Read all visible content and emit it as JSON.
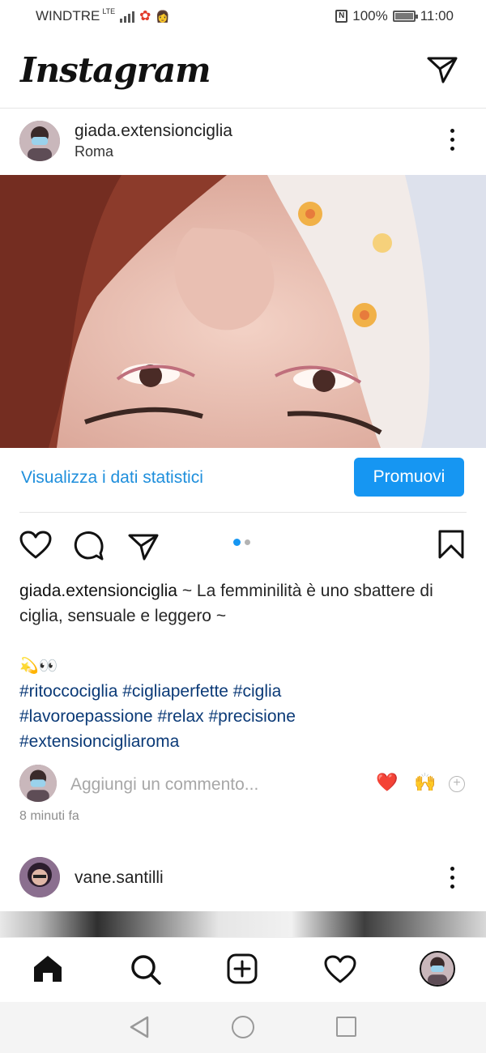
{
  "status_bar": {
    "carrier": "WINDTRE",
    "network": "LTE",
    "battery_percent": "100%",
    "time": "11:00"
  },
  "app": {
    "title": "Instagram"
  },
  "post": {
    "username": "giada.extensionciglia",
    "location": "Roma",
    "carousel_page": 1,
    "carousel_total": 2,
    "stats_link": "Visualizza i dati statistici",
    "promote_button": "Promuovi",
    "caption_username": "giada.extensionciglia",
    "caption_text": "~ La femminilità è uno sbattere di ciglia, sensuale e leggero ~",
    "emoji_line": "💫👀",
    "hashtags_line1": "#ritoccociglia #cigliaperfette #ciglia",
    "hashtags_line2": "#lavoroepassione  #relax #precisione",
    "hashtags_line3": "#extensioncigliaroma",
    "comment_placeholder": "Aggiungi un commento...",
    "quick_reactions": [
      "❤️",
      "🙌"
    ],
    "timestamp": "8 minuti fa"
  },
  "next_post": {
    "username": "vane.santilli"
  },
  "colors": {
    "link_blue": "#1f8fdc",
    "button_blue": "#1696f2",
    "hashtag_blue": "#0b3a77",
    "heart_red": "#e52b2b"
  },
  "icons": {
    "tab_bar": [
      "home-icon",
      "search-icon",
      "create-post-icon",
      "activity-heart-icon",
      "profile-avatar-icon"
    ],
    "post_actions": [
      "like-heart-icon",
      "comment-icon",
      "share-icon",
      "bookmark-icon"
    ]
  }
}
